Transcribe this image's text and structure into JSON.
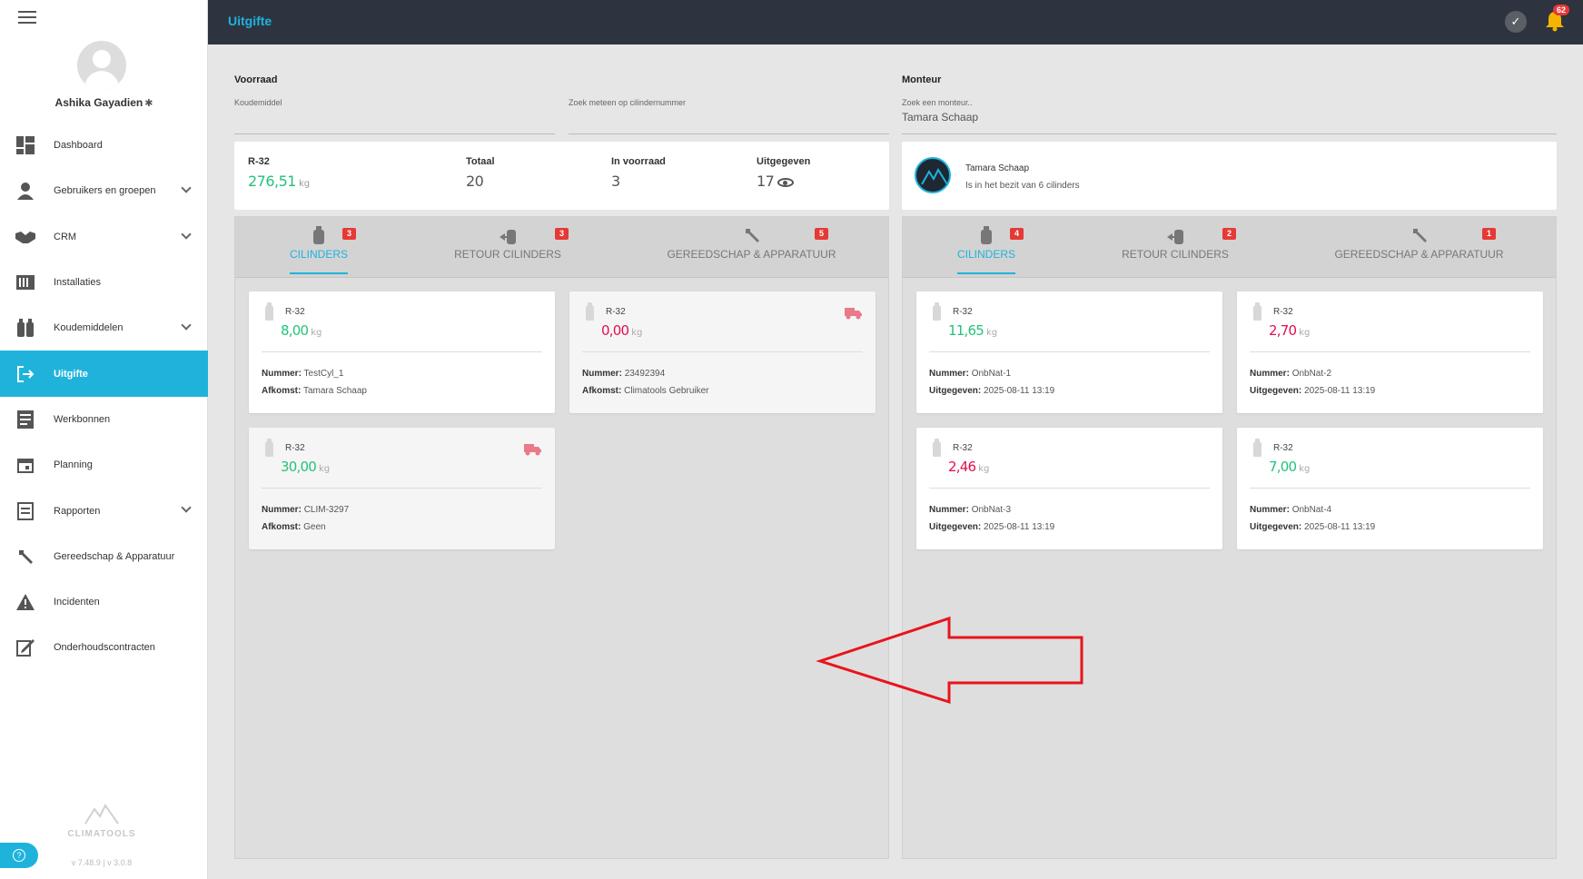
{
  "user": {
    "name": "Ashika Gayadien"
  },
  "sidebar": {
    "items": [
      {
        "label": "Dashboard",
        "icon": "dashboard-icon",
        "chevron": false,
        "active": false
      },
      {
        "label": "Gebruikers en groepen",
        "icon": "users-icon",
        "chevron": true,
        "active": false
      },
      {
        "label": "CRM",
        "icon": "handshake-icon",
        "chevron": true,
        "active": false
      },
      {
        "label": "Installaties",
        "icon": "installation-icon",
        "chevron": false,
        "active": false
      },
      {
        "label": "Koudemiddelen",
        "icon": "cylinders-icon",
        "chevron": true,
        "active": false
      },
      {
        "label": "Uitgifte",
        "icon": "exit-icon",
        "chevron": false,
        "active": true
      },
      {
        "label": "Werkbonnen",
        "icon": "workorder-icon",
        "chevron": false,
        "active": false
      },
      {
        "label": "Planning",
        "icon": "calendar-icon",
        "chevron": false,
        "active": false
      },
      {
        "label": "Rapporten",
        "icon": "report-icon",
        "chevron": true,
        "active": false
      },
      {
        "label": "Gereedschap & Apparatuur",
        "icon": "wrench-icon",
        "chevron": false,
        "active": false
      },
      {
        "label": "Incidenten",
        "icon": "warning-icon",
        "chevron": false,
        "active": false
      },
      {
        "label": "Onderhoudscontracten",
        "icon": "contract-icon",
        "chevron": false,
        "active": false
      }
    ],
    "logo_text": "CLIMATOOLS",
    "version": "v 7.48.9  | v 3.0.8"
  },
  "header": {
    "title": "Uitgifte",
    "notification_count": "62"
  },
  "voorraad": {
    "title": "Voorraad",
    "refrigerant_label": "Koudemiddel",
    "refrigerant_value": "",
    "search_label": "Zoek meteen op cilindernummer",
    "search_value": "",
    "stats": {
      "gas": "R-32",
      "gas_weight": "276,51",
      "unit": "kg",
      "total_label": "Totaal",
      "total": "20",
      "instock_label": "In voorraad",
      "instock": "3",
      "issued_label": "Uitgegeven",
      "issued": "17"
    },
    "tabs": [
      {
        "label": "CILINDERS",
        "badge": "3"
      },
      {
        "label": "RETOUR CILINDERS",
        "badge": "3"
      },
      {
        "label": "GEREEDSCHAP & APPARATUUR",
        "badge": "5"
      }
    ],
    "cards": [
      {
        "gas": "R-32",
        "weight": "8,00",
        "unit": "kg",
        "weight_color": "green",
        "line1_label": "Nummer:",
        "line1": "TestCyl_1",
        "line2_label": "Afkomst:",
        "line2": "Tamara Schaap",
        "truck": false
      },
      {
        "gas": "R-32",
        "weight": "0,00",
        "unit": "kg",
        "weight_color": "red",
        "line1_label": "Nummer:",
        "line1": "23492394",
        "line2_label": "Afkomst:",
        "line2": "Climatools Gebruiker",
        "truck": true
      },
      {
        "gas": "R-32",
        "weight": "30,00",
        "unit": "kg",
        "weight_color": "green",
        "line1_label": "Nummer:",
        "line1": "CLIM-3297",
        "line2_label": "Afkomst:",
        "line2": "Geen",
        "truck": true
      }
    ]
  },
  "monteur": {
    "title": "Monteur",
    "search_label": "Zoek een monteur..",
    "search_value": "Tamara Schaap",
    "name": "Tamara Schaap",
    "subtitle": "Is in het bezit van 6 cilinders",
    "tabs": [
      {
        "label": "CILINDERS",
        "badge": "4"
      },
      {
        "label": "RETOUR CILINDERS",
        "badge": "2"
      },
      {
        "label": "GEREEDSCHAP & APPARATUUR",
        "badge": "1"
      }
    ],
    "cards": [
      {
        "gas": "R-32",
        "weight": "11,65",
        "unit": "kg",
        "weight_color": "green",
        "line1_label": "Nummer:",
        "line1": "OnbNat-1",
        "line2_label": "Uitgegeven:",
        "line2": "2025-08-11 13:19"
      },
      {
        "gas": "R-32",
        "weight": "2,70",
        "unit": "kg",
        "weight_color": "red",
        "line1_label": "Nummer:",
        "line1": "OnbNat-2",
        "line2_label": "Uitgegeven:",
        "line2": "2025-08-11 13:19"
      },
      {
        "gas": "R-32",
        "weight": "2,46",
        "unit": "kg",
        "weight_color": "red",
        "line1_label": "Nummer:",
        "line1": "OnbNat-3",
        "line2_label": "Uitgegeven:",
        "line2": "2025-08-11 13:19"
      },
      {
        "gas": "R-32",
        "weight": "7,00",
        "unit": "kg",
        "weight_color": "green",
        "line1_label": "Nummer:",
        "line1": "OnbNat-4",
        "line2_label": "Uitgegeven:",
        "line2": "2025-08-11 13:19"
      }
    ]
  },
  "colors": {
    "accent": "#1fb3dc",
    "header_bg": "#2d3440",
    "green": "#23c37a",
    "red": "#e0114d",
    "badge": "#e53935",
    "annotation": "#e8141c"
  }
}
